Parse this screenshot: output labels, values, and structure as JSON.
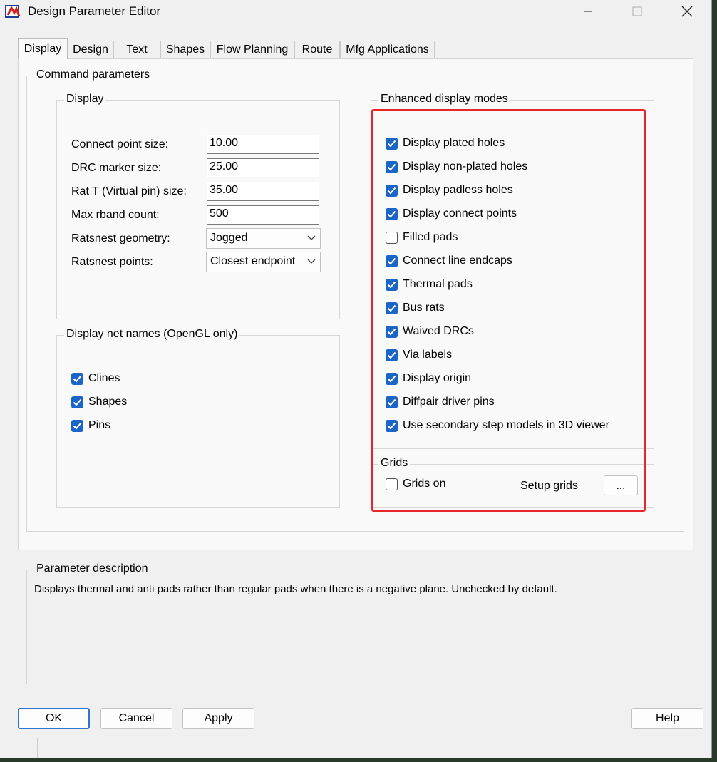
{
  "window": {
    "title": "Design Parameter Editor"
  },
  "tabs": [
    "Display",
    "Design",
    "Text",
    "Shapes",
    "Flow Planning",
    "Route",
    "Mfg Applications"
  ],
  "command_parameters": {
    "label": "Command parameters",
    "display": {
      "label": "Display",
      "fields": [
        {
          "label": "Connect point size:",
          "value": "10.00"
        },
        {
          "label": "DRC marker size:",
          "value": "25.00"
        },
        {
          "label": "Rat T (Virtual pin) size:",
          "value": "35.00"
        },
        {
          "label": "Max rband count:",
          "value": "500"
        }
      ],
      "selects": [
        {
          "label": "Ratsnest geometry:",
          "value": "Jogged"
        },
        {
          "label": "Ratsnest points:",
          "value": "Closest endpoint"
        }
      ]
    },
    "net_names": {
      "label": "Display net names (OpenGL only)",
      "items": [
        {
          "label": "Clines",
          "checked": true
        },
        {
          "label": "Shapes",
          "checked": true
        },
        {
          "label": "Pins",
          "checked": true
        }
      ]
    },
    "enhanced": {
      "label": "Enhanced display modes",
      "items": [
        {
          "label": "Display plated holes",
          "checked": true
        },
        {
          "label": "Display non-plated holes",
          "checked": true
        },
        {
          "label": "Display padless holes",
          "checked": true
        },
        {
          "label": "Display connect points",
          "checked": true
        },
        {
          "label": "Filled pads",
          "checked": false
        },
        {
          "label": "Connect line endcaps",
          "checked": true
        },
        {
          "label": "Thermal pads",
          "checked": true
        },
        {
          "label": "Bus rats",
          "checked": true
        },
        {
          "label": "Waived DRCs",
          "checked": true
        },
        {
          "label": "Via labels",
          "checked": true
        },
        {
          "label": "Display origin",
          "checked": true
        },
        {
          "label": "Diffpair driver pins",
          "checked": true
        },
        {
          "label": "Use secondary step models in 3D viewer",
          "checked": true
        }
      ]
    },
    "grids": {
      "label": "Grids",
      "grids_on": {
        "label": "Grids on",
        "checked": false
      },
      "setup_label": "Setup grids",
      "setup_button": "..."
    }
  },
  "parameter_description": {
    "label": "Parameter description",
    "text": "Displays thermal and anti pads rather than regular pads when there is a negative plane. Unchecked by default."
  },
  "buttons": {
    "ok": "OK",
    "cancel": "Cancel",
    "apply": "Apply",
    "help": "Help"
  },
  "colors": {
    "checkbox_on": "#1b65c6",
    "highlight": "#e8262a"
  },
  "icons": {
    "app": "app-icon",
    "minimize": "minimize-icon",
    "maximize": "maximize-icon",
    "close": "close-icon",
    "chevron": "chevron-down-icon",
    "check": "check-icon"
  }
}
